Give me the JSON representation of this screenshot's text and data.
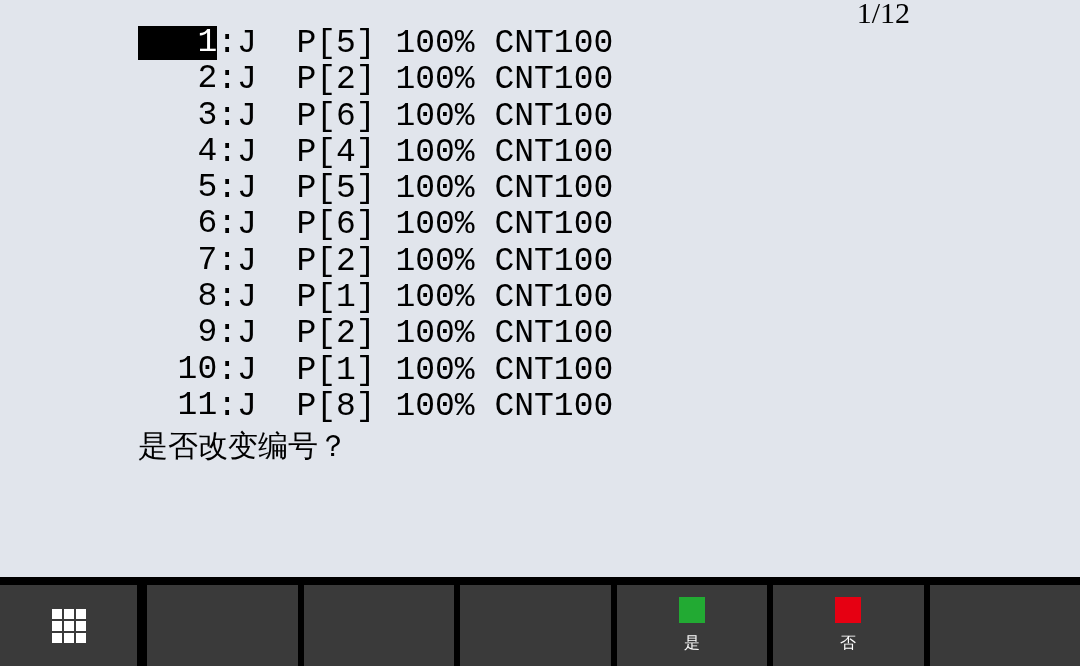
{
  "page_indicator": "1/12",
  "lines": [
    {
      "number": "1",
      "text": ":J  P[5] 100% CNT100",
      "selected": true
    },
    {
      "number": "2",
      "text": ":J  P[2] 100% CNT100",
      "selected": false
    },
    {
      "number": "3",
      "text": ":J  P[6] 100% CNT100",
      "selected": false
    },
    {
      "number": "4",
      "text": ":J  P[4] 100% CNT100",
      "selected": false
    },
    {
      "number": "5",
      "text": ":J  P[5] 100% CNT100",
      "selected": false
    },
    {
      "number": "6",
      "text": ":J  P[6] 100% CNT100",
      "selected": false
    },
    {
      "number": "7",
      "text": ":J  P[2] 100% CNT100",
      "selected": false
    },
    {
      "number": "8",
      "text": ":J  P[1] 100% CNT100",
      "selected": false
    },
    {
      "number": "9",
      "text": ":J  P[2] 100% CNT100",
      "selected": false
    },
    {
      "number": "10",
      "text": ":J  P[1] 100% CNT100",
      "selected": false
    },
    {
      "number": "11",
      "text": ":J  P[8] 100% CNT100",
      "selected": false
    }
  ],
  "prompt": "是否改变编号？",
  "function_keys": [
    {
      "kind": "menu"
    },
    {
      "kind": "blank"
    },
    {
      "kind": "blank"
    },
    {
      "kind": "blank"
    },
    {
      "kind": "choice",
      "label": "是",
      "color": "#22aa33"
    },
    {
      "kind": "choice",
      "label": "否",
      "color": "#e60012"
    },
    {
      "kind": "blank"
    }
  ]
}
